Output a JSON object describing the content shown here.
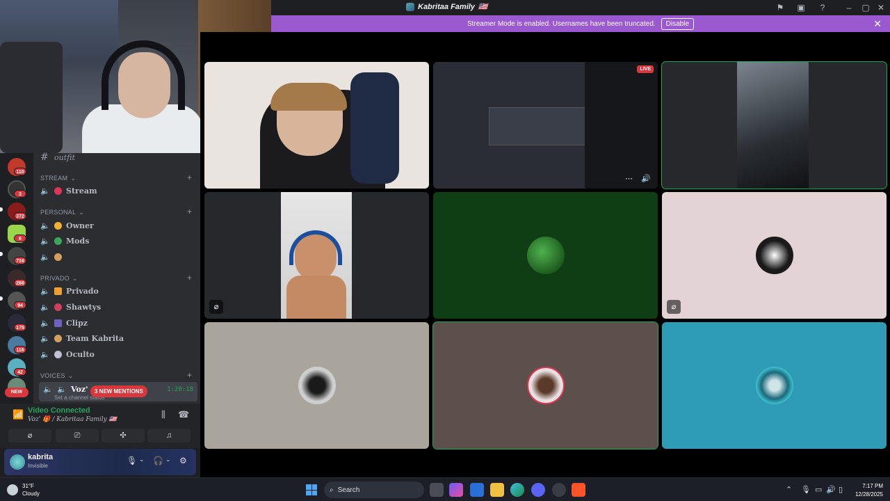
{
  "window": {
    "title": "Kabritaa Family",
    "flag_emoji": "🇺🇸"
  },
  "banner": {
    "text": "Streamer Mode is enabled. Usernames have been truncated.",
    "button": "Disable"
  },
  "servers": [
    {
      "badge": "110",
      "color": "#c0392b"
    },
    {
      "badge": "3",
      "color": "#333"
    },
    {
      "badge": "372",
      "color": "#8b1a1a"
    },
    {
      "badge": "6",
      "color": "#9bd64a"
    },
    {
      "badge": "716",
      "color": "#444"
    },
    {
      "badge": "266",
      "color": "#3a2a2a"
    },
    {
      "badge": "94",
      "color": "#555"
    },
    {
      "badge": "175",
      "color": "#2a2a3a"
    },
    {
      "badge": "116",
      "color": "#4a7aa0"
    },
    {
      "badge": "42",
      "color": "#5ab0c0"
    }
  ],
  "new_pill": "NEW",
  "channels": {
    "top_channel": "outfit",
    "categories": [
      {
        "name": "STREAM",
        "channels": [
          {
            "name": "Stream",
            "emoji_color": "#e0345a"
          }
        ]
      },
      {
        "name": "PERSONAL",
        "channels": [
          {
            "name": "Owner",
            "emoji_color": "#f0b232"
          },
          {
            "name": "Mods",
            "emoji_color": "#3ba55c"
          },
          {
            "name": "",
            "emoji_color": "#d4a060"
          }
        ]
      },
      {
        "name": "PRIVADO",
        "channels": [
          {
            "name": "Privado",
            "emoji_color": "#f0a030"
          },
          {
            "name": "Shawtys",
            "emoji_color": "#d04060"
          },
          {
            "name": "Clipz",
            "emoji_color": "#7060c0"
          },
          {
            "name": "Team Kabrita",
            "emoji_color": "#d4a060"
          },
          {
            "name": "Oculto",
            "emoji_color": "#c0c0d0"
          }
        ]
      },
      {
        "name": "VOICES",
        "channels": []
      }
    ],
    "voice_channel": {
      "name": "Voz'",
      "status": "Set a channel status",
      "time": "1:20:18"
    },
    "mentions_pill": "3 NEW MENTIONS"
  },
  "voice_panel": {
    "status": "Video Connected",
    "location": "Voz' 🎁 / Kabritaa Family 🇺🇸"
  },
  "user": {
    "name": "kabrita",
    "status": "Invisible"
  },
  "stage": {
    "live_label": "LIVE"
  },
  "taskbar": {
    "temperature": "31°F",
    "weather": "Cloudy",
    "search_placeholder": "Search",
    "time": "7:17 PM",
    "date": "12/28/2025"
  }
}
